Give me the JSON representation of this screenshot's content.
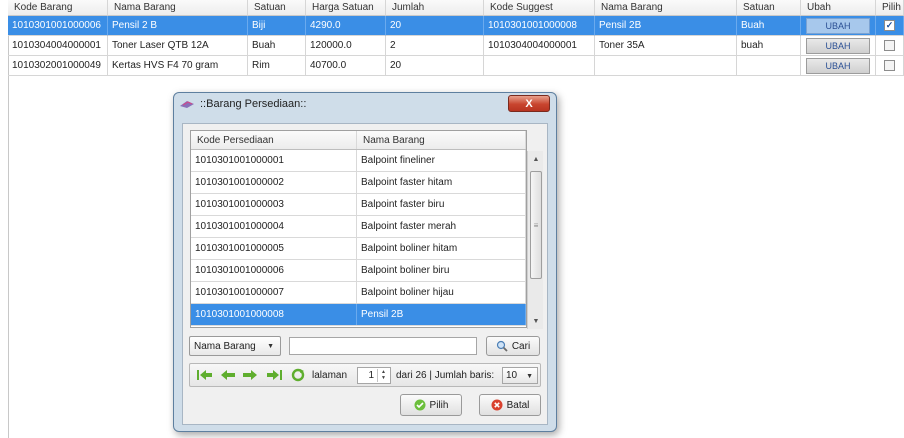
{
  "main_table": {
    "columns": [
      "Kode Barang",
      "Nama Barang",
      "Satuan",
      "Harga Satuan",
      "Jumlah",
      "Kode Suggest",
      "Nama Barang",
      "Satuan",
      "Ubah",
      "Pilih"
    ],
    "rows": [
      {
        "kode": "1010301001000006",
        "nama": "Pensil 2 B",
        "satuan": "Biji",
        "harga": "4290.0",
        "jumlah": "20",
        "kode_suggest": "1010301001000008",
        "nama_suggest": "Pensil 2B",
        "satuan_suggest": "Buah",
        "ubah": "UBAH",
        "pilih": true,
        "selected": true
      },
      {
        "kode": "1010304004000001",
        "nama": "Toner Laser QTB 12A",
        "satuan": "Buah",
        "harga": "120000.0",
        "jumlah": "2",
        "kode_suggest": "1010304004000001",
        "nama_suggest": "Toner 35A",
        "satuan_suggest": "buah",
        "ubah": "UBAH",
        "pilih": false,
        "selected": false
      },
      {
        "kode": "1010302001000049",
        "nama": "Kertas HVS F4 70 gram",
        "satuan": "Rim",
        "harga": "40700.0",
        "jumlah": "20",
        "kode_suggest": "",
        "nama_suggest": "",
        "satuan_suggest": "",
        "ubah": "UBAH",
        "pilih": false,
        "selected": false
      }
    ]
  },
  "dialog": {
    "title": "::Barang Persediaan::",
    "close_label": "X",
    "grid_columns": [
      "Kode Persediaan",
      "Nama Barang"
    ],
    "grid_rows": [
      {
        "kode": "1010301001000001",
        "nama": "Balpoint fineliner",
        "selected": false
      },
      {
        "kode": "1010301001000002",
        "nama": "Balpoint faster hitam",
        "selected": false
      },
      {
        "kode": "1010301001000003",
        "nama": "Balpoint faster biru",
        "selected": false
      },
      {
        "kode": "1010301001000004",
        "nama": "Balpoint faster merah",
        "selected": false
      },
      {
        "kode": "1010301001000005",
        "nama": "Balpoint boliner hitam",
        "selected": false
      },
      {
        "kode": "1010301001000006",
        "nama": "Balpoint boliner biru",
        "selected": false
      },
      {
        "kode": "1010301001000007",
        "nama": "Balpoint boliner hijau",
        "selected": false
      },
      {
        "kode": "1010301001000008",
        "nama": "Pensil 2B",
        "selected": true
      }
    ],
    "search": {
      "field_selected": "Nama Barang",
      "input_value": "",
      "button_label": "Cari"
    },
    "pager": {
      "halaman_label": "lalaman",
      "current_page": "1",
      "page_info": "dari 26  | Jumlah baris:",
      "rows_per_page": "10"
    },
    "buttons": {
      "pilih": "Pilih",
      "batal": "Batal"
    }
  },
  "colors": {
    "selection": "#3a8ee6",
    "close_button": "#c8452e",
    "pager_arrow": "#5fae2e",
    "dialog_frame": "#cfdde9"
  }
}
